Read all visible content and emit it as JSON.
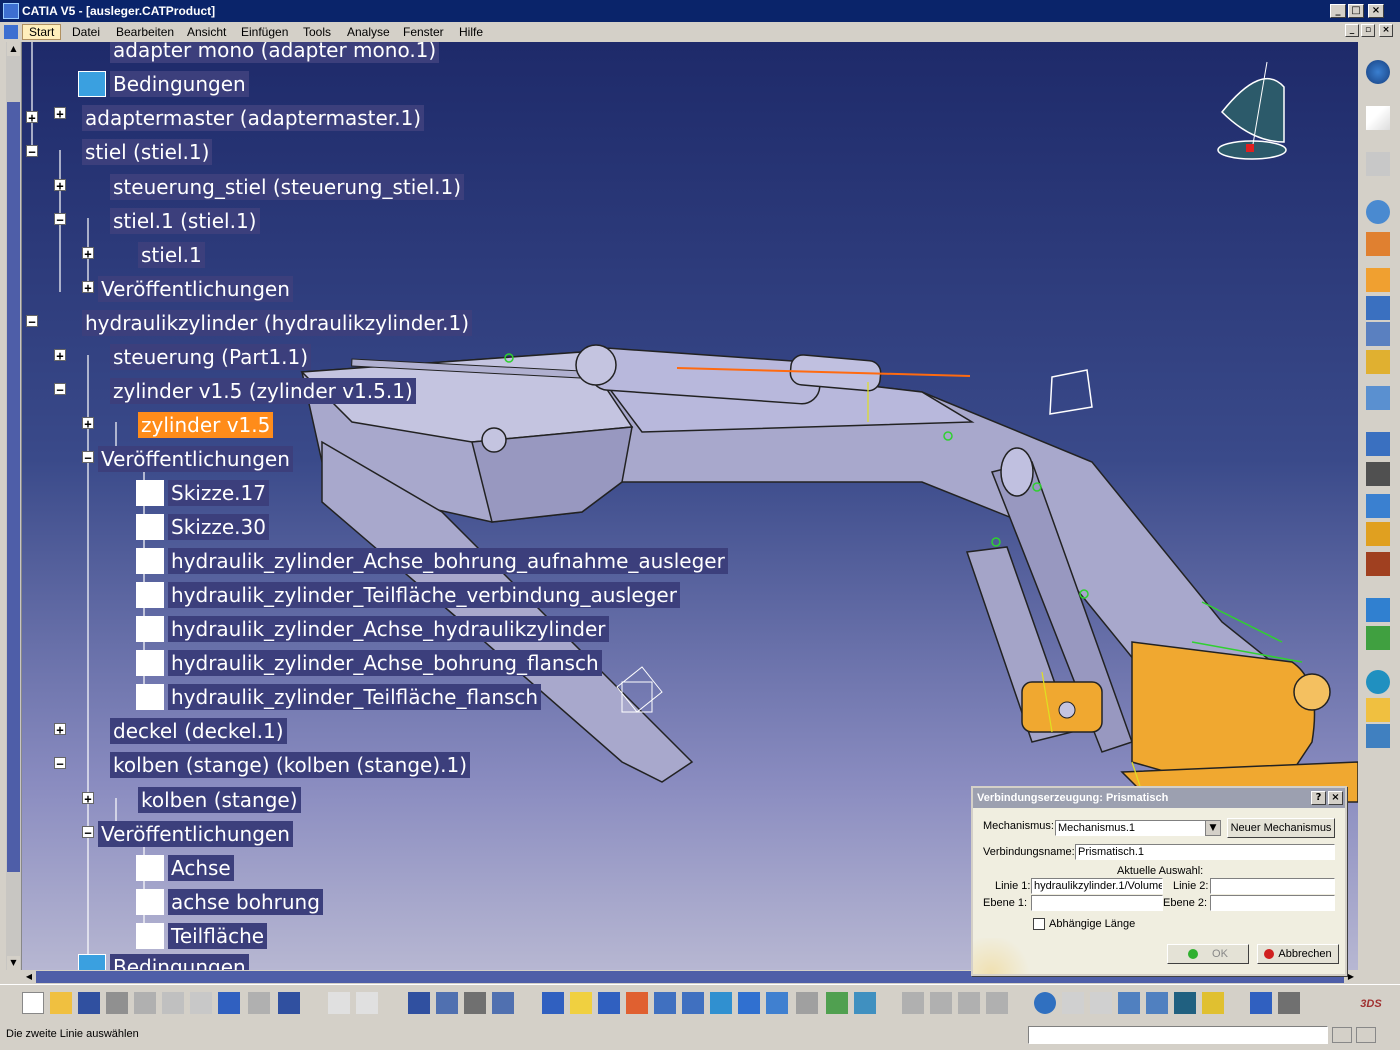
{
  "window": {
    "title": "CATIA V5 - [ausleger.CATProduct]"
  },
  "menu": {
    "items": [
      "Start",
      "Datei",
      "Bearbeiten",
      "Ansicht",
      "Einfügen",
      "Tools",
      "Analyse",
      "Fenster",
      "Hilfe"
    ]
  },
  "tree": {
    "nodes": [
      "adapter mono (adapter mono.1)",
      "Bedingungen",
      "adaptermaster (adaptermaster.1)",
      "stiel (stiel.1)",
      "steuerung_stiel (steuerung_stiel.1)",
      "stiel.1 (stiel.1)",
      "stiel.1",
      "Veröffentlichungen",
      "hydraulikzylinder (hydraulikzylinder.1)",
      "steuerung (Part1.1)",
      "zylinder v1.5 (zylinder v1.5.1)",
      "zylinder v1.5",
      "Veröffentlichungen",
      "Skizze.17",
      "Skizze.30",
      "hydraulik_zylinder_Achse_bohrung_aufnahme_ausleger",
      "hydraulik_zylinder_Teilfläche_verbindung_ausleger",
      "hydraulik_zylinder_Achse_hydraulikzylinder",
      "hydraulik_zylinder_Achse_bohrung_flansch",
      "hydraulik_zylinder_Teilfläche_flansch",
      "deckel (deckel.1)",
      "kolben (stange) (kolben (stange).1)",
      "kolben (stange)",
      "Veröffentlichungen",
      "Achse",
      "achse bohrung",
      "Teilfläche",
      "Bedingungen"
    ]
  },
  "dialog": {
    "title": "Verbindungserzeugung: Prismatisch",
    "mechanismus_label": "Mechanismus:",
    "mechanismus_value": "Mechanismus.1",
    "neuer_button": "Neuer Mechanismus",
    "name_label": "Verbindungsname:",
    "name_value": "Prismatisch.1",
    "auswahl_label": "Aktuelle Auswahl:",
    "linie1_label": "Linie 1:",
    "linie1_value": "hydraulikzylinder.1/Volume",
    "linie2_label": "Linie 2:",
    "linie2_value": "",
    "ebene1_label": "Ebene 1:",
    "ebene1_value": "",
    "ebene2_label": "Ebene 2:",
    "ebene2_value": "",
    "checkbox_label": "Abhängige Länge",
    "ok_label": "OK",
    "cancel_label": "Abbrechen"
  },
  "status": {
    "message": "Die zweite Linie auswählen"
  },
  "colors": {
    "selection": "#ff8c1a",
    "tree_label_bg": "#3c3f7c",
    "excavator": "#a8a8cc",
    "flange": "#f0a830"
  }
}
